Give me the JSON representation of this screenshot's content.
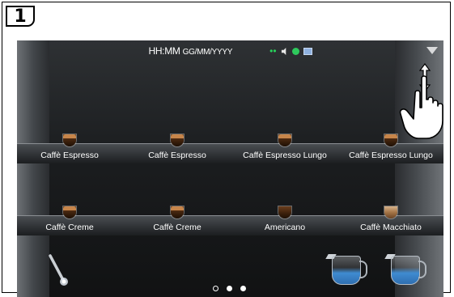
{
  "step_number": "1",
  "status_bar": {
    "time": "HH:MM",
    "date": "GG/MM/YYYY"
  },
  "beverages_row1": [
    {
      "label": "Caffè Espresso",
      "icon": "espresso-cup-icon"
    },
    {
      "label": "Caffè Espresso",
      "icon": "double-espresso-cup-icon"
    },
    {
      "label": "Caffè Espresso Lungo",
      "icon": "espresso-lungo-cup-icon"
    },
    {
      "label": "Caffè Espresso Lungo",
      "icon": "double-espresso-lungo-cup-icon"
    }
  ],
  "beverages_row2": [
    {
      "label": "Caffè Creme",
      "icon": "creme-cup-icon"
    },
    {
      "label": "Caffè Creme",
      "icon": "double-creme-cup-icon"
    },
    {
      "label": "Americano",
      "icon": "americano-cup-icon"
    },
    {
      "label": "Caffè Macchiato",
      "icon": "macchiato-glass-icon"
    }
  ],
  "colors": {
    "wifi": "#27d35b",
    "status_dot": "#2ec95c",
    "milk_jug": "#3f8bd1"
  },
  "page_indicator": {
    "pages": 3,
    "current": 1
  }
}
